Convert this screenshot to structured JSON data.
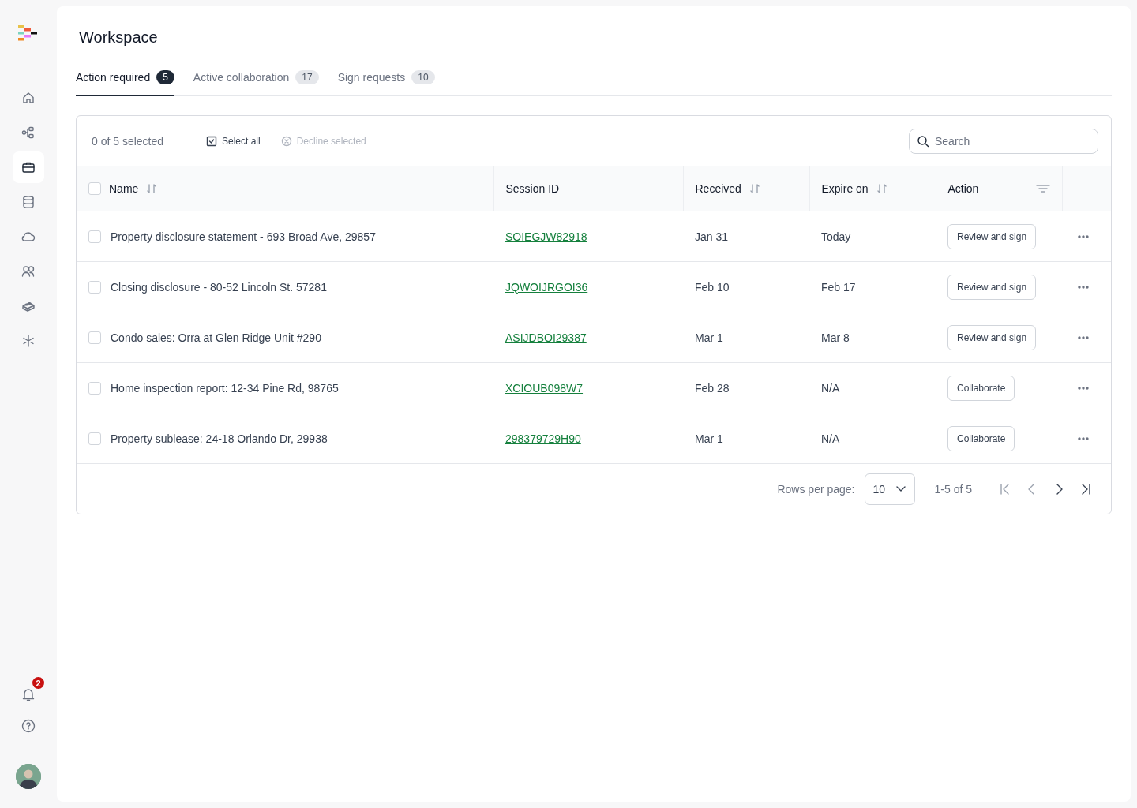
{
  "sidebar": {
    "items": [
      {
        "kind": "home",
        "selected": false
      },
      {
        "kind": "flow",
        "selected": false
      },
      {
        "kind": "briefcase",
        "selected": true
      },
      {
        "kind": "database",
        "selected": false
      },
      {
        "kind": "cloud",
        "selected": false
      },
      {
        "kind": "users",
        "selected": false
      },
      {
        "kind": "brick",
        "selected": false
      },
      {
        "kind": "asterisk",
        "selected": false
      }
    ],
    "notifications": {
      "count": "2"
    }
  },
  "page_title": "Workspace",
  "tabs": [
    {
      "label": "Action required",
      "count": "5",
      "selected": true
    },
    {
      "label": "Active collaboration",
      "count": "17",
      "selected": false
    },
    {
      "label": "Sign requests",
      "count": "10",
      "selected": false
    }
  ],
  "toolbar": {
    "selection_text": "0 of 5 selected",
    "select_all": "Select all",
    "decline": {
      "label": "Decline selected",
      "disabled": true
    },
    "search": {
      "placeholder": "Search"
    }
  },
  "table": {
    "all_checked": false,
    "columns": [
      {
        "label": "Name",
        "kind": "sortable"
      },
      {
        "label": "Session ID",
        "kind": "plain"
      },
      {
        "label": "Received",
        "kind": "sortable"
      },
      {
        "label": "Expire on",
        "kind": "sortable"
      },
      {
        "label": "Action",
        "kind": "filter"
      }
    ],
    "rows": [
      {
        "checked": false,
        "name": "Property disclosure statement - 693 Broad Ave, 29857",
        "session_id": "SOIEGJW82918",
        "received": "Jan 31",
        "expire": "Today",
        "action": "Review and sign"
      },
      {
        "checked": false,
        "name": "Closing disclosure - 80-52 Lincoln St. 57281",
        "session_id": "JQWOIJRGOI36",
        "received": "Feb 10",
        "expire": "Feb 17",
        "action": "Review and sign"
      },
      {
        "checked": false,
        "name": "Condo sales: Orra at Glen Ridge Unit #290",
        "session_id": "ASIJDBOI29387",
        "received": "Mar 1",
        "expire": "Mar 8",
        "action": "Review and sign"
      },
      {
        "checked": false,
        "name": "Home inspection report: 12-34 Pine Rd, 98765",
        "session_id": "XCIOUB098W7",
        "received": "Feb 28",
        "expire": "N/A",
        "action": "Collaborate"
      },
      {
        "checked": false,
        "name": "Property sublease: 24-18 Orlando Dr, 29938",
        "session_id": "298379729H90",
        "received": "Mar 1",
        "expire": "N/A",
        "action": "Collaborate"
      }
    ]
  },
  "pagination": {
    "rows_per_page_label": "Rows per page:",
    "rows_per_page": "10",
    "range": "1-5 of 5"
  }
}
